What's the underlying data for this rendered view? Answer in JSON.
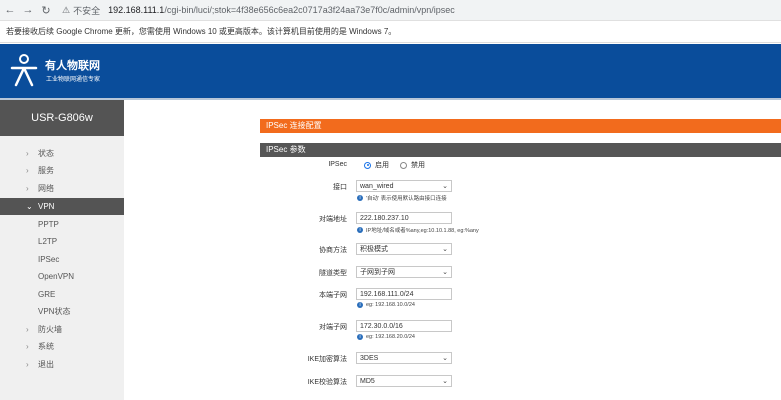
{
  "browser": {
    "back_icon": "back-arrow-icon",
    "forward_icon": "forward-arrow-icon",
    "reload_icon": "reload-icon",
    "security_label": "不安全",
    "url_host": "192.168.111.1",
    "url_path": "/cgi-bin/luci/;stok=4f38e656c6ea2c0717a3f24aa73e7f0c/admin/vpn/ipsec"
  },
  "infobar": {
    "message": "若要接收后续 Google Chrome 更新，您需使用 Windows 10 或更高版本。该计算机目前使用的是 Windows 7。"
  },
  "header": {
    "brand": "有人物联网",
    "subtitle": "工业物联网通信专家",
    "colors": {
      "header_bg": "#0a4d9b",
      "accent": "#f26b1d",
      "section": "#565656"
    }
  },
  "sidebar": {
    "device": "USR-G806w",
    "items": [
      {
        "label": "状态",
        "type": "group"
      },
      {
        "label": "服务",
        "type": "group"
      },
      {
        "label": "网络",
        "type": "group"
      },
      {
        "label": "VPN",
        "type": "group-open"
      },
      {
        "label": "PPTP",
        "type": "sub"
      },
      {
        "label": "L2TP",
        "type": "sub"
      },
      {
        "label": "IPSec",
        "type": "sub"
      },
      {
        "label": "OpenVPN",
        "type": "sub"
      },
      {
        "label": "GRE",
        "type": "sub"
      },
      {
        "label": "VPN状态",
        "type": "sub"
      },
      {
        "label": "防火墙",
        "type": "group"
      },
      {
        "label": "系统",
        "type": "group"
      },
      {
        "label": "退出",
        "type": "group"
      }
    ]
  },
  "main": {
    "section_title": "IPSec 连接配置",
    "params_title": "IPSec 参数",
    "ipsec": {
      "label": "IPSec",
      "enable": "启用",
      "disable": "禁用"
    },
    "interface": {
      "label": "接口",
      "value": "wan_wired",
      "hint": "'自动' 表示使用默认路由接口连接"
    },
    "remote_addr": {
      "label": "对端地址",
      "value": "222.180.237.10",
      "hint": "IP地址/域名或者%any,eg:10.10.1.88, eg:%any"
    },
    "negotiation": {
      "label": "协商方法",
      "value": "积极模式"
    },
    "tunnel_type": {
      "label": "隧道类型",
      "value": "子网到子网"
    },
    "local_subnet": {
      "label": "本端子网",
      "value": "192.168.111.0/24",
      "hint": "eg: 192.168.10.0/24"
    },
    "remote_subnet": {
      "label": "对端子网",
      "value": "172.30.0.0/16",
      "hint": "eg: 192.168.20.0/24"
    },
    "ike_enc": {
      "label": "IKE加密算法",
      "value": "3DES"
    },
    "ike_auth": {
      "label": "IKE校验算法",
      "value": "MD5"
    }
  }
}
